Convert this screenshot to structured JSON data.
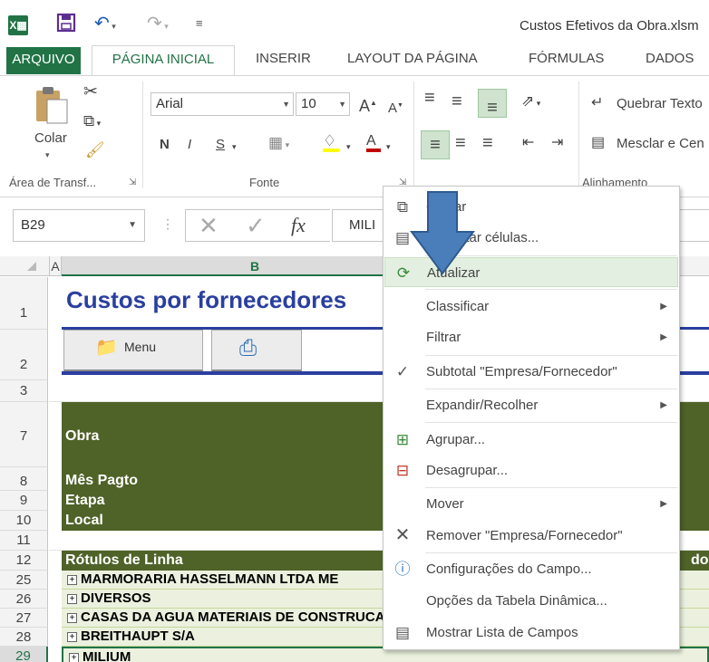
{
  "window": {
    "title": "Custos Efetivos da Obra.xlsm"
  },
  "quick_access": {
    "icons": [
      "excel-logo",
      "save-icon",
      "undo-icon",
      "redo-icon",
      "customize-icon"
    ]
  },
  "tabs": [
    "ARQUIVO",
    "PÁGINA INICIAL",
    "INSERIR",
    "LAYOUT DA PÁGINA",
    "FÓRMULAS",
    "DADOS"
  ],
  "ribbon": {
    "paste_label": "Colar",
    "clipboard_group": "Área de Transf...",
    "font_name": "Arial",
    "font_size": "10",
    "grow_font": "A",
    "shrink_font": "A",
    "bold": "N",
    "italic": "I",
    "underline": "S",
    "font_group": "Fonte",
    "wrap_text": "Quebrar Texto",
    "merge_center": "Mesclar e Cen",
    "alignment_group": "Alinhamento"
  },
  "formula_bar": {
    "name_box": "B29",
    "value": "MILI",
    "fx": "fx"
  },
  "grid": {
    "col_a": "A",
    "col_b": "B",
    "rows": {
      "r1": "1",
      "r2": "2",
      "r3": "3",
      "r7": "7",
      "r8": "8",
      "r9": "9",
      "r10": "10",
      "r11": "11",
      "r12": "12",
      "r25": "25",
      "r26": "26",
      "r27": "27",
      "r28": "28",
      "r29": "29"
    },
    "heading": "Custos por fornecedores",
    "menu_button": "Menu",
    "labels": {
      "obra": "Obra",
      "mes": "Mês Pagto",
      "etapa": "Etapa",
      "local": "Local"
    },
    "pivot_header": "Rótulos de Linha",
    "pivot_header_right": "do",
    "pivot_rows": [
      "MARMORARIA HASSELMANN LTDA ME",
      "DIVERSOS",
      "CASAS DA AGUA MATERIAIS DE CONSTRUCAO LTDA",
      "BREITHAUPT S/A",
      "MILIUM"
    ]
  },
  "context_menu": {
    "items": [
      {
        "label": "Copiar",
        "icon": "copy-icon"
      },
      {
        "label": "Formatar células...",
        "icon": "format-cells-icon"
      },
      {
        "label": "Atualizar",
        "icon": "refresh-icon"
      },
      {
        "label": "Classificar",
        "icon": ""
      },
      {
        "label": "Filtrar",
        "icon": ""
      },
      {
        "label": "Subtotal \"Empresa/Fornecedor\"",
        "icon": "check-icon"
      },
      {
        "label": "Expandir/Recolher",
        "icon": ""
      },
      {
        "label": "Agrupar...",
        "icon": "group-icon"
      },
      {
        "label": "Desagrupar...",
        "icon": "ungroup-icon"
      },
      {
        "label": "Mover",
        "icon": ""
      },
      {
        "label": "Remover \"Empresa/Fornecedor\"",
        "icon": "remove-icon"
      },
      {
        "label": "Configurações do Campo...",
        "icon": "field-settings-icon"
      },
      {
        "label": "Opções da Tabela Dinâmica...",
        "icon": ""
      },
      {
        "label": "Mostrar Lista de Campos",
        "icon": "field-list-icon"
      }
    ]
  },
  "colors": {
    "excel_green": "#217346",
    "dark_green": "#4f6228",
    "light_green": "#ebf1de",
    "arrow_blue": "#4a7ebb",
    "heading_blue": "#2a3f9f"
  }
}
